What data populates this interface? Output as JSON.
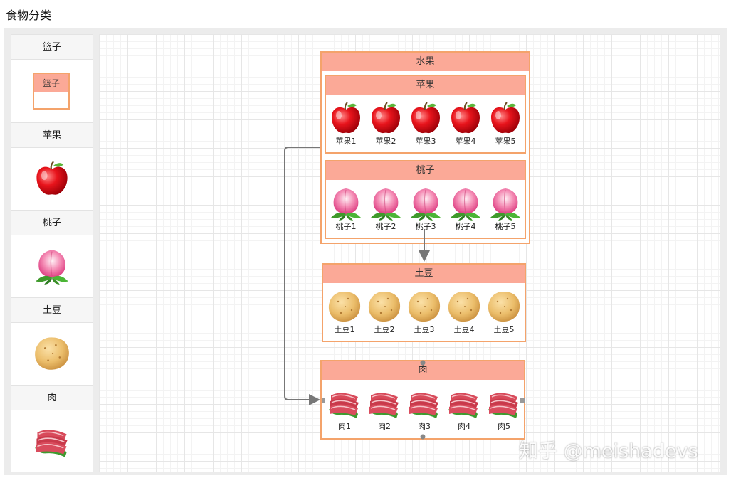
{
  "page": {
    "title": "食物分类"
  },
  "sidebar": {
    "items": [
      {
        "label": "篮子",
        "preview_label": "篮子"
      },
      {
        "label": "苹果",
        "icon": "apple-icon"
      },
      {
        "label": "桃子",
        "icon": "peach-icon"
      },
      {
        "label": "土豆",
        "icon": "potato-icon"
      },
      {
        "label": "肉",
        "icon": "meat-icon"
      }
    ]
  },
  "canvas": {
    "groups": {
      "fruit": {
        "title": "水果",
        "apple": {
          "title": "苹果",
          "items": [
            "苹果1",
            "苹果2",
            "苹果3",
            "苹果4",
            "苹果5"
          ]
        },
        "peach": {
          "title": "桃子",
          "items": [
            "桃子1",
            "桃子2",
            "桃子3",
            "桃子4",
            "桃子5"
          ]
        }
      },
      "potato": {
        "title": "土豆",
        "items": [
          "土豆1",
          "土豆2",
          "土豆3",
          "土豆4",
          "土豆5"
        ]
      },
      "meat": {
        "title": "肉",
        "items": [
          "肉1",
          "肉2",
          "肉3",
          "肉4",
          "肉5"
        ]
      }
    }
  },
  "colors": {
    "border": "#f4a36b",
    "header": "#fba997",
    "edge": "#777777"
  },
  "watermark": "知乎 @meishadevs"
}
